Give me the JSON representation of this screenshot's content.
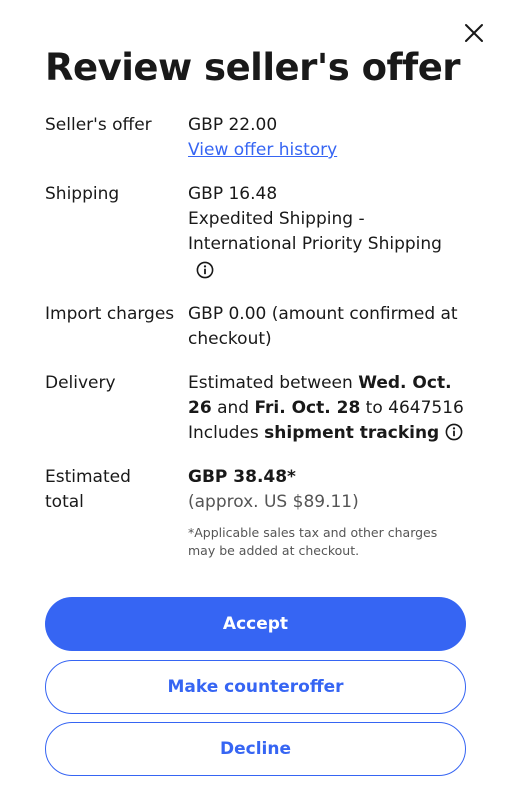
{
  "dialog": {
    "title": "Review seller's offer"
  },
  "offer": {
    "label": "Seller's offer",
    "amount": "GBP 22.00",
    "history_link": "View offer history"
  },
  "shipping": {
    "label": "Shipping",
    "amount": "GBP 16.48",
    "method_line1": "Expedited Shipping -",
    "method_line2": "International Priority Shipping"
  },
  "import": {
    "label": "Import charges",
    "value": "GBP 0.00 (amount confirmed at checkout)"
  },
  "delivery": {
    "label": "Delivery",
    "prefix": "Estimated between ",
    "date_from": "Wed. Oct. 26",
    "and": " and ",
    "date_to": "Fri. Oct. 28",
    "suffix": " to 4647516",
    "tracking_prefix": "Includes ",
    "tracking": "shipment tracking"
  },
  "total": {
    "label": "Estimated total",
    "amount": "GBP 38.48*",
    "approx": "(approx. US $89.11)",
    "disclaimer": "*Applicable sales tax and other charges may be added at checkout."
  },
  "actions": {
    "accept": "Accept",
    "counter": "Make counteroffer",
    "decline": "Decline"
  },
  "colors": {
    "accent": "#3665f3",
    "text": "#191919",
    "muted": "#555555"
  },
  "icons": {
    "close": "close-icon",
    "info": "info-icon"
  }
}
